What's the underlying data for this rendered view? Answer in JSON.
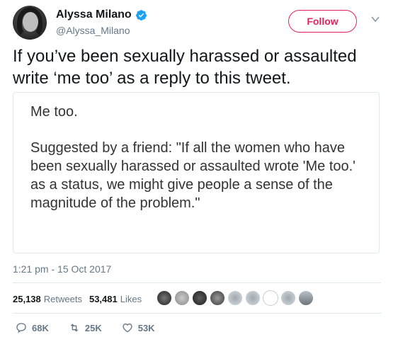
{
  "header": {
    "display_name": "Alyssa Milano",
    "handle": "@Alyssa_Milano",
    "follow_label": "Follow"
  },
  "tweet": {
    "text": "If you’ve been sexually harassed or assaulted write ‘me too’ as a reply to this tweet.",
    "quote_line1": "Me too.",
    "quote_para": "Suggested by a friend: \"If all the women who have been sexually harassed or assaulted wrote 'Me too.' as a status, we might give people a sense of the magnitude of the problem.\"",
    "timestamp": "1:21 pm - 15 Oct 2017"
  },
  "stats": {
    "retweets_count": "25,138",
    "retweets_label": "Retweets",
    "likes_count": "53,481",
    "likes_label": "Likes"
  },
  "actions": {
    "reply_count": "68K",
    "retweet_count": "25K",
    "like_count": "53K"
  },
  "colors": {
    "follow_accent": "#e0245e",
    "verified": "#1da1f2",
    "muted": "#657786"
  }
}
